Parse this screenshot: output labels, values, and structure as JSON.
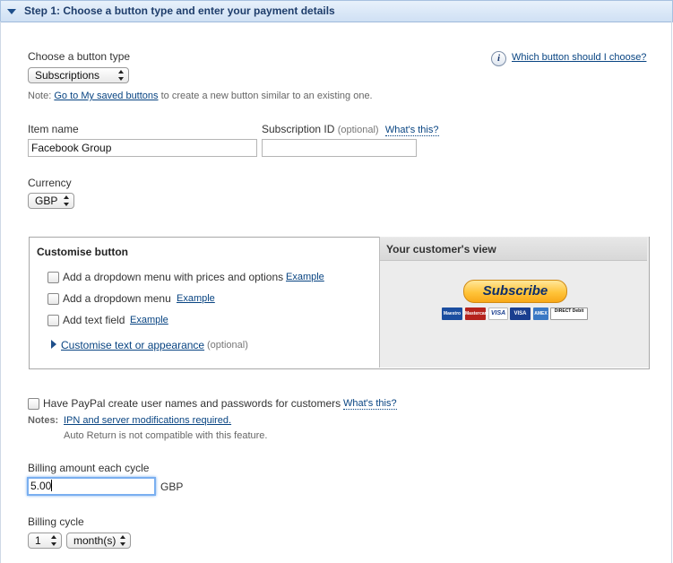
{
  "header": {
    "title": "Step 1: Choose a button type and enter your payment details"
  },
  "button_type": {
    "label": "Choose a button type",
    "selected": "Subscriptions",
    "help_link": "Which button should I choose?",
    "note_prefix": "Note:",
    "note_link": "Go to My saved buttons",
    "note_suffix": "to create a new button similar to an existing one."
  },
  "item": {
    "name_label": "Item name",
    "name_value": "Facebook Group",
    "sub_id_label": "Subscription ID",
    "optional": "(optional)",
    "whats_this": "What's this?",
    "sub_id_value": ""
  },
  "currency": {
    "label": "Currency",
    "selected": "GBP"
  },
  "customise": {
    "title": "Customise button",
    "options": [
      {
        "label": "Add a dropdown menu with prices and options",
        "example": "Example"
      },
      {
        "label": "Add a dropdown menu",
        "example": "Example"
      },
      {
        "label": "Add text field",
        "example": "Example"
      }
    ],
    "appearance_link": "Customise text or appearance",
    "appearance_optional": "(optional)"
  },
  "preview": {
    "title": "Your customer's view",
    "button_label": "Subscribe",
    "cards": [
      "Maestro",
      "Mastercard",
      "VISA",
      "VISA",
      "AMEX",
      "DIRECT Debit"
    ]
  },
  "paypal_accounts": {
    "label": "Have PayPal create user names and passwords for customers",
    "whats_this": "What's this?",
    "notes_label": "Notes:",
    "notes_link": "IPN and server modifications required.",
    "notes_second": "Auto Return is not compatible with this feature."
  },
  "billing_amount": {
    "label": "Billing amount each cycle",
    "value": "5.00",
    "currency": "GBP"
  },
  "billing_cycle": {
    "label": "Billing cycle",
    "count": "1",
    "unit": "month(s)"
  }
}
